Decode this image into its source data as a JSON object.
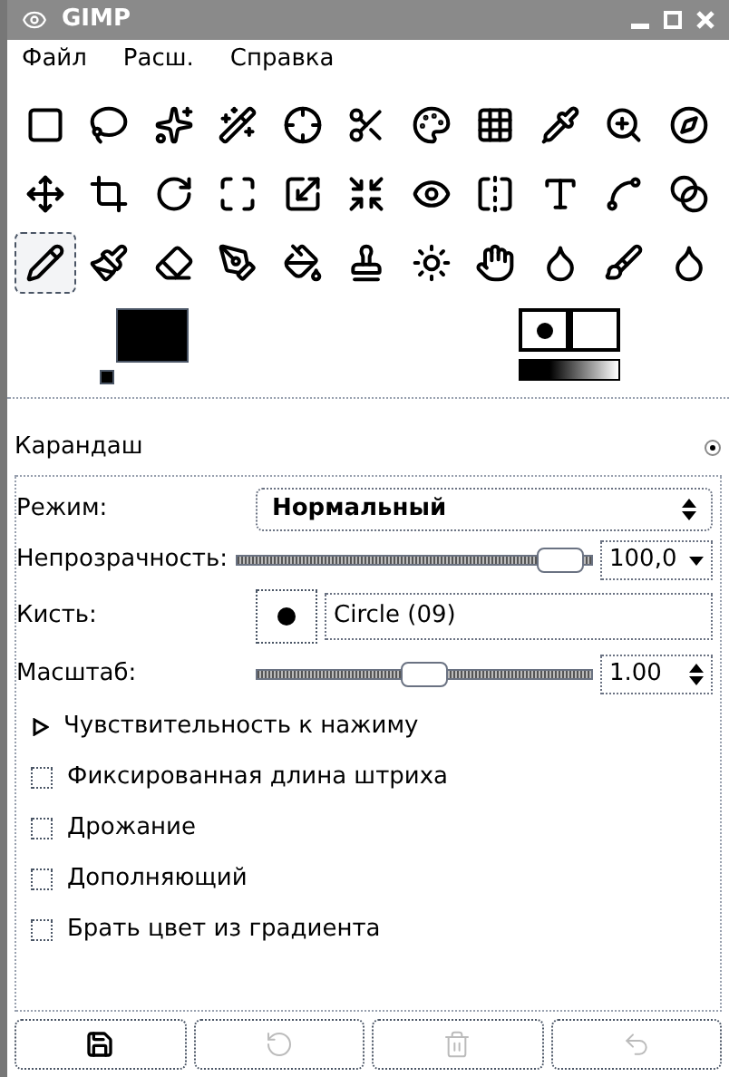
{
  "window": {
    "title": "GIMP"
  },
  "menu": [
    "Файл",
    "Расш.",
    "Справка"
  ],
  "tools": [
    {
      "selected": false
    },
    {
      "selected": false
    },
    {
      "selected": false
    },
    {
      "selected": false
    },
    {
      "selected": false
    },
    {
      "selected": false
    },
    {
      "selected": false
    },
    {
      "selected": false
    },
    {
      "selected": false
    },
    {
      "selected": false
    },
    {
      "selected": false
    },
    {
      "selected": false
    },
    {
      "selected": false
    },
    {
      "selected": false
    },
    {
      "selected": false
    },
    {
      "selected": false
    },
    {
      "selected": false
    },
    {
      "selected": false
    },
    {
      "selected": false
    },
    {
      "selected": false
    },
    {
      "selected": false
    },
    {
      "selected": false
    },
    {
      "selected": true
    },
    {
      "selected": false
    },
    {
      "selected": false
    },
    {
      "selected": false
    },
    {
      "selected": false
    },
    {
      "selected": false
    },
    {
      "selected": false
    },
    {
      "selected": false
    },
    {
      "selected": false
    },
    {
      "selected": false
    },
    {
      "selected": false
    }
  ],
  "tool_options": {
    "title": "Карандаш",
    "mode": {
      "label": "Режим:",
      "value": "Нормальный"
    },
    "opacity": {
      "label": "Непрозрачность:",
      "level": 0.97,
      "reading": "100,0"
    },
    "brush": {
      "label": "Кисть:",
      "value": "Circle (09)"
    },
    "scale": {
      "label": "Масштаб:",
      "level": 0.5,
      "reading": "1.00"
    },
    "pressure": {
      "label": "Чувствительность к нажиму",
      "expanded": false
    },
    "options": [
      {
        "label": "Фиксированная длина штриха",
        "checked": false
      },
      {
        "label": "Дрожание",
        "checked": false
      },
      {
        "label": "Дополняющий",
        "checked": false
      },
      {
        "label": "Брать цвет из градиента",
        "checked": false
      }
    ]
  },
  "bottom_buttons": [
    {
      "disabled": false
    },
    {
      "disabled": true
    },
    {
      "disabled": true
    },
    {
      "disabled": true
    }
  ]
}
